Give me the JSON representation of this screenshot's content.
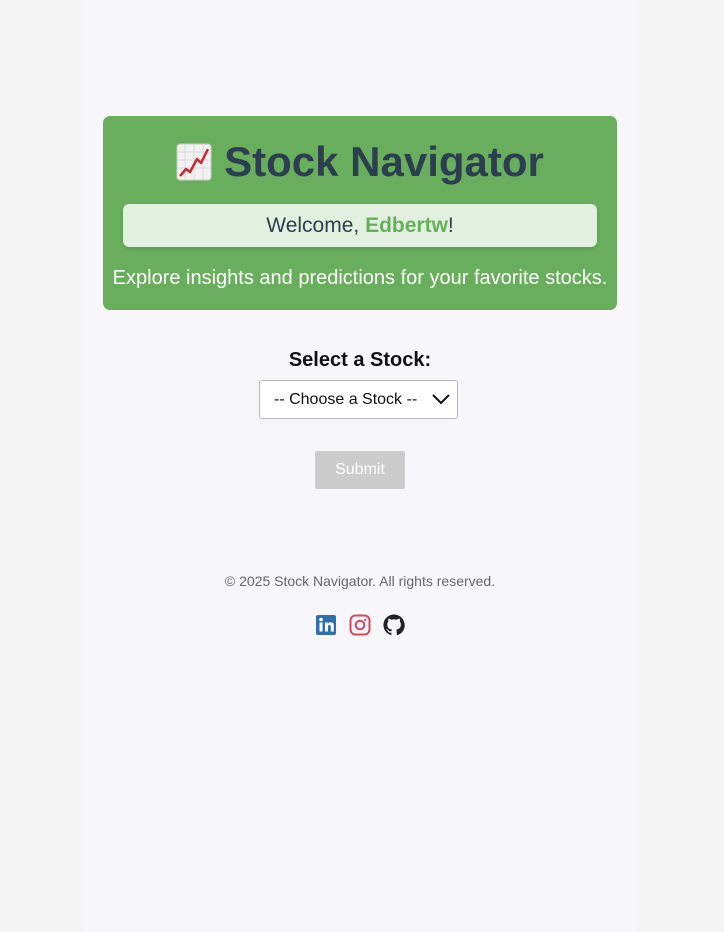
{
  "header": {
    "title": "Stock Navigator",
    "title_icon": "chart-increasing-icon",
    "welcome_prefix": "Welcome, ",
    "username": "Edbertw",
    "welcome_suffix": "!",
    "tagline": "Explore insights and predictions for your favorite stocks."
  },
  "form": {
    "label": "Select a Stock:",
    "select_value": "-- Choose a Stock --",
    "submit_label": "Submit"
  },
  "footer": {
    "copyright": "© 2025 Stock Navigator. All rights reserved.",
    "social_icons": [
      "linkedin-icon",
      "instagram-icon",
      "github-icon"
    ]
  },
  "colors": {
    "accent_green": "#69ae5c",
    "title_dark": "#2c3e50",
    "welcome_bg": "#e2f0e0",
    "disabled_button": "#cccccc",
    "linkedin": "#2f6fac",
    "instagram": "#d5475f",
    "github": "#222222"
  }
}
